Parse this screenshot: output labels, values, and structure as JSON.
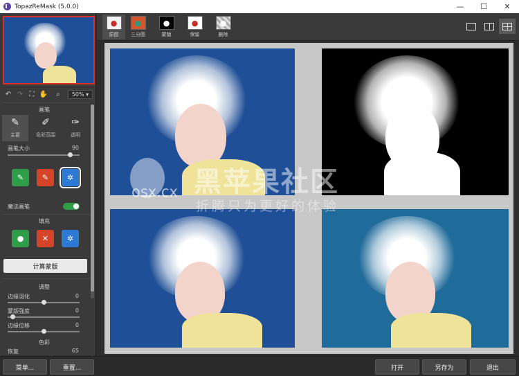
{
  "window": {
    "title": "TopazReMask (5.0.0)",
    "minimize": "—",
    "maximize": "☐",
    "close": "✕"
  },
  "toolbar": {
    "zoom": "50%"
  },
  "brush": {
    "title": "画笔",
    "tools": [
      "主要",
      "色彩范围",
      "透明"
    ],
    "size_label": "画笔大小",
    "size_value": "90",
    "size_level": 0.9,
    "magic_label": "魔法画笔",
    "magic_on": true
  },
  "fill": {
    "title": "填充"
  },
  "compute_label": "计算蒙版",
  "adjust": {
    "title": "调整",
    "items": [
      {
        "label": "边缘羽化",
        "value": "0",
        "level": 0.5
      },
      {
        "label": "蒙版强度",
        "value": "0",
        "level": 0.04
      },
      {
        "label": "边缘位移",
        "value": "0",
        "level": 0.5
      }
    ]
  },
  "color": {
    "title": "色彩",
    "restore_label": "恢复",
    "restore_value": "65"
  },
  "modes": [
    "原图",
    "三分图",
    "蒙版",
    "保留",
    "删除"
  ],
  "watermark": {
    "big": "黑苹果社区",
    "osx": "osx.cx",
    "sub": "折腾只为更好的体验"
  },
  "bottom": {
    "menu": "菜单...",
    "reset": "重置...",
    "open": "打开",
    "save_as": "另存为",
    "exit": "退出"
  },
  "colors": {
    "accent_red": "#d8302a",
    "blue_bg": "#1f4f96",
    "teal_bg": "#1f6b9a",
    "green": "#2e9e49"
  }
}
